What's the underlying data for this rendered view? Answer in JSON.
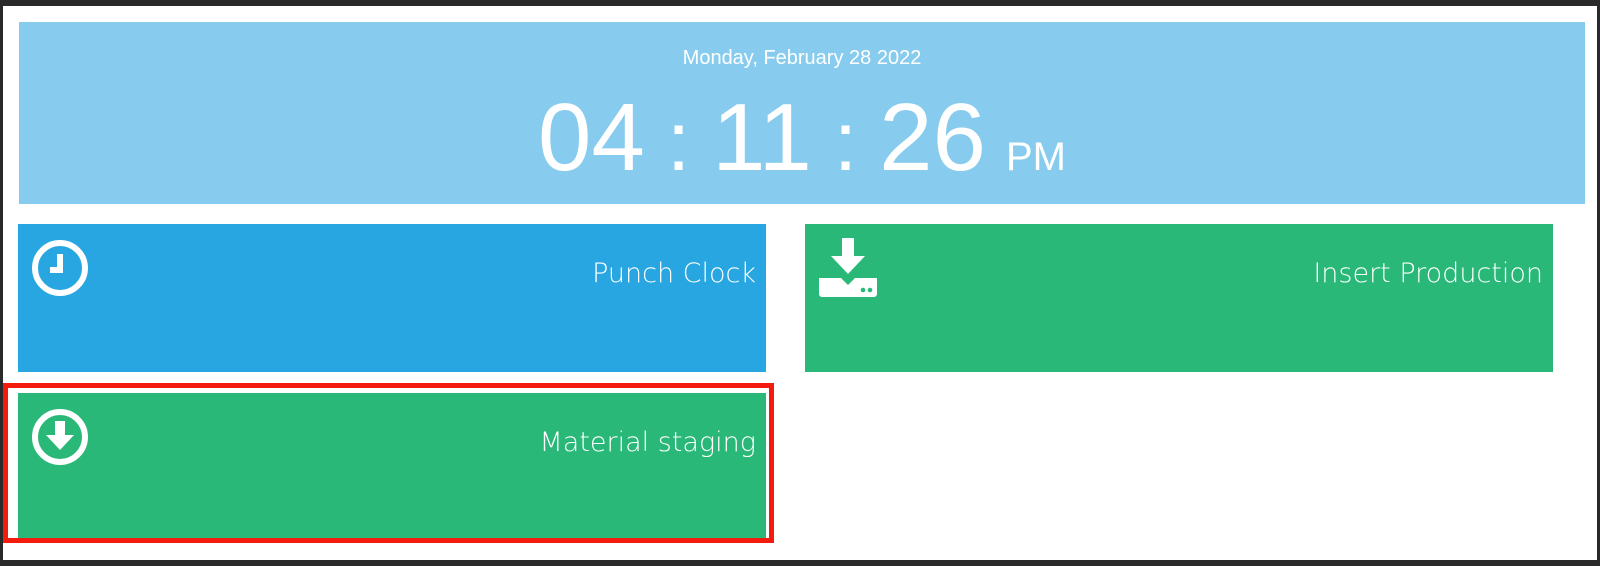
{
  "header": {
    "date": "Monday, February 28 2022",
    "hours": "04",
    "minutes": "11",
    "seconds": "26",
    "separator": ":",
    "ampm": "PM"
  },
  "tiles": [
    {
      "label": "Punch Clock",
      "icon": "clock-icon",
      "color": "#27a6e1"
    },
    {
      "label": "Insert Production",
      "icon": "download-tray-icon",
      "color": "#2ab878"
    },
    {
      "label": "Material staging",
      "icon": "arrow-down-circle-icon",
      "color": "#2ab878"
    }
  ],
  "colors": {
    "clock_panel": "#87ccef",
    "highlight": "#f21b0e"
  }
}
